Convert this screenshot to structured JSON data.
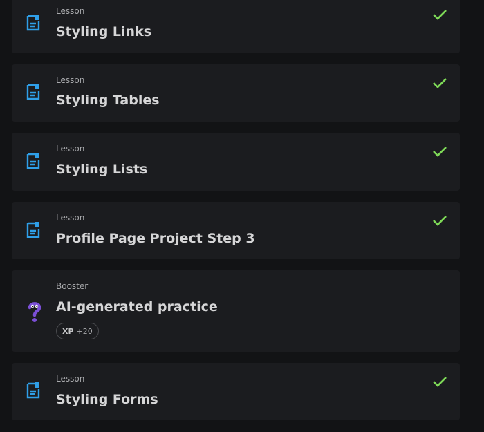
{
  "items": [
    {
      "kind": "Lesson",
      "title": "Styling Links",
      "completed": true,
      "icon": "lesson-document-icon"
    },
    {
      "kind": "Lesson",
      "title": "Styling Tables",
      "completed": true,
      "icon": "lesson-document-icon"
    },
    {
      "kind": "Lesson",
      "title": "Styling Lists",
      "completed": true,
      "icon": "lesson-document-icon"
    },
    {
      "kind": "Lesson",
      "title": "Profile Page Project Step 3",
      "completed": true,
      "icon": "lesson-document-icon"
    },
    {
      "kind": "Booster",
      "title": "AI-generated practice",
      "completed": false,
      "icon": "question-mark-mascot-icon",
      "xp": {
        "label": "XP",
        "value": "+20"
      }
    },
    {
      "kind": "Lesson",
      "title": "Styling Forms",
      "completed": true,
      "icon": "lesson-document-icon"
    }
  ],
  "colors": {
    "accent_blue": "#2f9fe8",
    "check_green": "#7ed957",
    "booster_purple": "#7b4fd6"
  }
}
